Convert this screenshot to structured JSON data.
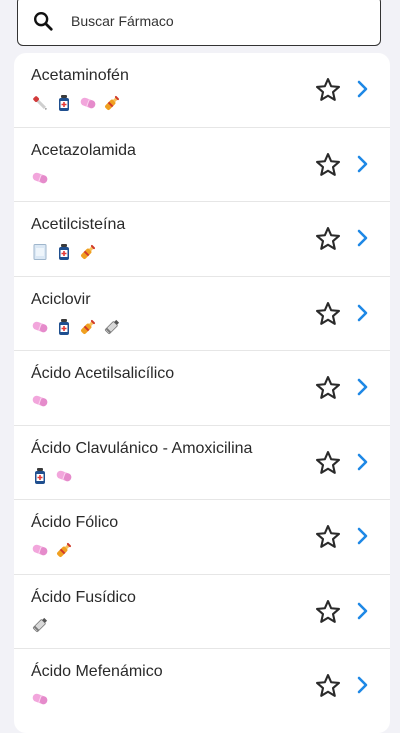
{
  "search": {
    "placeholder": "Buscar Fármaco"
  },
  "colors": {
    "accent": "#1e88e5",
    "pill": "#f2a6dc",
    "star_outline": "#2a2a2a"
  },
  "drugs": [
    {
      "name": "Acetaminofén",
      "forms": [
        "dropper",
        "bottle",
        "pill",
        "ampoule"
      ]
    },
    {
      "name": "Acetazolamida",
      "forms": [
        "pill"
      ]
    },
    {
      "name": "Acetilcisteína",
      "forms": [
        "sachet",
        "bottle",
        "ampoule"
      ]
    },
    {
      "name": "Aciclovir",
      "forms": [
        "pill",
        "bottle",
        "ampoule",
        "tube"
      ]
    },
    {
      "name": "Ácido Acetilsalicílico",
      "forms": [
        "pill"
      ]
    },
    {
      "name": "Ácido Clavulánico - Amoxicilina",
      "forms": [
        "bottle",
        "pill"
      ]
    },
    {
      "name": "Ácido Fólico",
      "forms": [
        "pill",
        "ampoule"
      ]
    },
    {
      "name": "Ácido Fusídico",
      "forms": [
        "tube"
      ]
    },
    {
      "name": "Ácido Mefenámico",
      "forms": [
        "pill"
      ]
    }
  ]
}
